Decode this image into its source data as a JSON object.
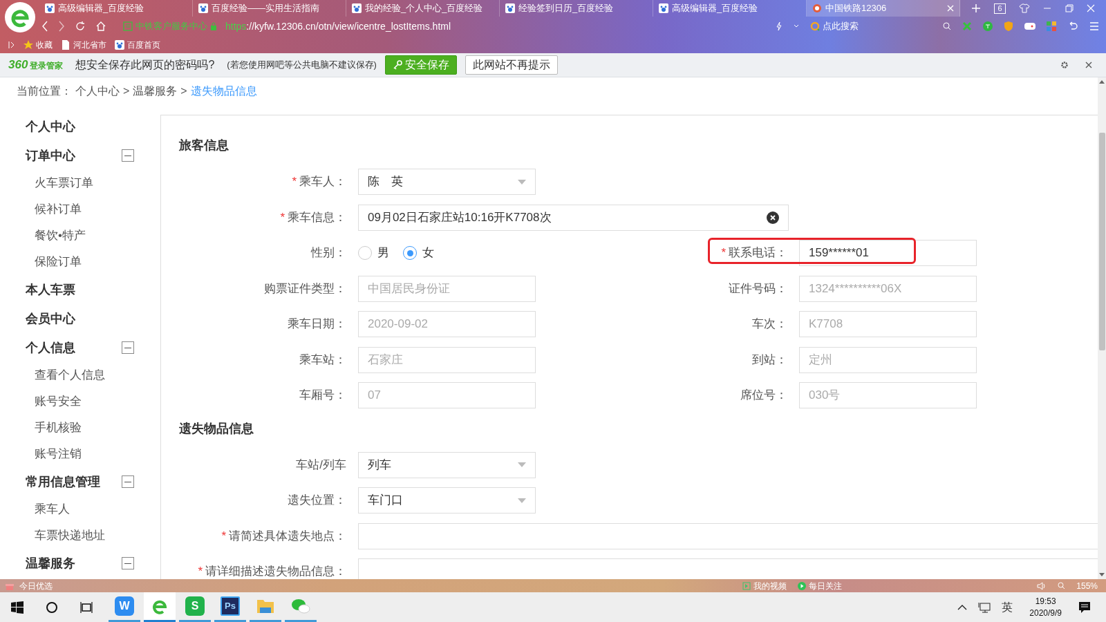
{
  "browser": {
    "tabs": [
      {
        "title": "高级编辑器_百度经验",
        "selected": false,
        "kind": "paw"
      },
      {
        "title": "百度经验——实用生活指南",
        "selected": false,
        "kind": "paw"
      },
      {
        "title": "我的经验_个人中心_百度经验",
        "selected": false,
        "kind": "paw"
      },
      {
        "title": "经验签到日历_百度经验",
        "selected": false,
        "kind": "paw"
      },
      {
        "title": "高级编辑器_百度经验",
        "selected": false,
        "kind": "paw"
      },
      {
        "title": "中国铁路12306",
        "selected": true,
        "kind": "rail"
      }
    ],
    "tab_count": "6",
    "site_name": "中铁客户服务中心",
    "url_scheme": "https",
    "url_rest": "://kyfw.12306.cn/otn/view/icentre_lostItems.html",
    "search_placeholder": "点此搜索",
    "bookmarks": [
      {
        "label": "收藏",
        "kind": "star"
      },
      {
        "label": "河北省市",
        "kind": "page"
      },
      {
        "label": "百度首页",
        "kind": "paw"
      }
    ]
  },
  "password_bar": {
    "brand_number": "360",
    "brand_name": "登录管家",
    "question": "想安全保存此网页的密码吗?",
    "note": "(若您使用网吧等公共电脑不建议保存)",
    "save_button": "安全保存",
    "dismiss_button": "此网站不再提示"
  },
  "breadcrumb": {
    "prefix": "当前位置：",
    "items": [
      {
        "text": "个人中心",
        "current": false
      },
      {
        "text": "温馨服务",
        "current": false
      },
      {
        "text": "遗失物品信息",
        "current": true
      }
    ],
    "separators": [
      ">",
      ">"
    ]
  },
  "sidebar": [
    {
      "title": "个人中心",
      "kind": "plain"
    },
    {
      "title": "订单中心",
      "kind": "toggle",
      "expanded": true,
      "children": [
        {
          "title": "火车票订单"
        },
        {
          "title": "候补订单"
        },
        {
          "title": "餐饮•特产"
        },
        {
          "title": "保险订单"
        }
      ]
    },
    {
      "title": "本人车票",
      "kind": "plain"
    },
    {
      "title": "会员中心",
      "kind": "plain"
    },
    {
      "title": "个人信息",
      "kind": "toggle",
      "expanded": true,
      "children": [
        {
          "title": "查看个人信息"
        },
        {
          "title": "账号安全"
        },
        {
          "title": "手机核验"
        },
        {
          "title": "账号注销"
        }
      ]
    },
    {
      "title": "常用信息管理",
      "kind": "toggle",
      "expanded": true,
      "children": [
        {
          "title": "乘车人"
        },
        {
          "title": "车票快递地址"
        }
      ]
    },
    {
      "title": "温馨服务",
      "kind": "toggle",
      "expanded": true
    }
  ],
  "form": {
    "sections": [
      {
        "title": "旅客信息",
        "rows": [
          [
            {
              "label": "乘车人：",
              "required_mark": "*",
              "kind": "select",
              "value": "陈　英"
            }
          ],
          [
            {
              "label": "乘车信息：",
              "required_mark": "*",
              "kind": "clearable",
              "value": "09月02日石家庄站10:16开K7708次",
              "disabled": false
            }
          ],
          [
            {
              "label": "性别：",
              "kind": "radio",
              "options": [
                {
                  "label": "男",
                  "selected": false
                },
                {
                  "label": "女",
                  "selected": true
                }
              ]
            },
            {
              "label": "联系电话：",
              "required_mark": "*",
              "kind": "text",
              "value": "159******01",
              "disabled": false,
              "highlighted": true
            }
          ],
          [
            {
              "label": "购票证件类型：",
              "kind": "text",
              "value": "中国居民身份证",
              "disabled": true
            },
            {
              "label": "证件号码：",
              "kind": "text",
              "value": "1324**********06X",
              "disabled": true
            }
          ],
          [
            {
              "label": "乘车日期：",
              "kind": "text",
              "value": "2020-09-02",
              "disabled": true
            },
            {
              "label": "车次：",
              "kind": "text",
              "value": "K7708",
              "disabled": true
            }
          ],
          [
            {
              "label": "乘车站：",
              "kind": "text",
              "value": "石家庄",
              "disabled": true
            },
            {
              "label": "到站：",
              "kind": "text",
              "value": "定州",
              "disabled": true
            }
          ],
          [
            {
              "label": "车厢号：",
              "kind": "text",
              "value": "07",
              "disabled": true
            },
            {
              "label": "席位号：",
              "kind": "text",
              "value": "030号",
              "disabled": true
            }
          ]
        ]
      },
      {
        "title": "遗失物品信息",
        "rows": [
          [
            {
              "label": "车站/列车",
              "kind": "select",
              "value": "列车"
            }
          ],
          [
            {
              "label": "遗失位置：",
              "kind": "select",
              "value": "车门口"
            }
          ],
          [
            {
              "label": "请简述具体遗失地点：",
              "required_mark": "*",
              "kind": "wide"
            }
          ],
          [
            {
              "label": "请详细描述遗失物品信息：",
              "required_mark": "*",
              "kind": "wide"
            }
          ]
        ]
      }
    ]
  },
  "status_bar": {
    "left": "今日优选",
    "items": [
      {
        "label": "我的视频",
        "kind": "video"
      },
      {
        "label": "每日关注",
        "kind": "play"
      }
    ],
    "zoom": "155%"
  },
  "taskbar": {
    "apps": [
      {
        "kind": "wps-writer",
        "label": "W",
        "selected": false
      },
      {
        "kind": "browser",
        "selected": true
      },
      {
        "kind": "wps-sheet",
        "label": "S",
        "selected": false
      },
      {
        "kind": "photoshop",
        "label": "Ps",
        "selected": false
      },
      {
        "kind": "folder",
        "selected": false
      },
      {
        "kind": "chat",
        "selected": false
      }
    ],
    "ime": "英",
    "time": "19:53",
    "date": "2020/9/9"
  }
}
